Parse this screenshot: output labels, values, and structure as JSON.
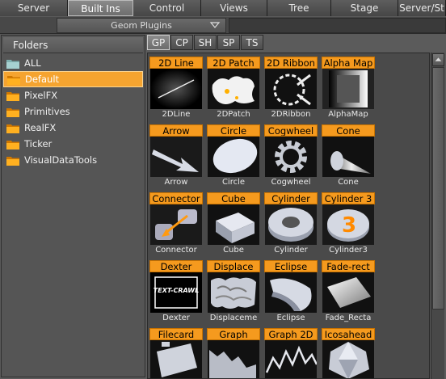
{
  "top_tabs": [
    "Server",
    "Built Ins",
    "Control",
    "Views",
    "Tree",
    "Stage",
    "Server/St"
  ],
  "active_top_tab": "Built Ins",
  "plugin_select": {
    "value": "Geom Plugins"
  },
  "folders_header": "Folders",
  "folders": [
    "ALL",
    "Default",
    "PixelFX",
    "Primitives",
    "RealFX",
    "Ticker",
    "VisualDataTools"
  ],
  "selected_folder": "Default",
  "sub_tabs": [
    "GP",
    "CP",
    "SH",
    "SP",
    "TS"
  ],
  "active_sub_tab": "GP",
  "items": [
    {
      "title": "2D Line",
      "caption": "2DLine",
      "icon": "line-icon"
    },
    {
      "title": "2D Patch",
      "caption": "2DPatch",
      "icon": "patch-icon"
    },
    {
      "title": "2D Ribbon",
      "caption": "2DRibbon",
      "icon": "ribbon-icon"
    },
    {
      "title": "Alpha Map",
      "caption": "AlphaMap",
      "icon": "alpha-map-icon"
    },
    {
      "title": "Arrow",
      "caption": "Arrow",
      "icon": "arrow-icon"
    },
    {
      "title": "Circle",
      "caption": "Circle",
      "icon": "circle-icon"
    },
    {
      "title": "Cogwheel",
      "caption": "Cogwheel",
      "icon": "cogwheel-icon"
    },
    {
      "title": "Cone",
      "caption": "Cone",
      "icon": "cone-icon"
    },
    {
      "title": "Connector",
      "caption": "Connector",
      "icon": "connector-icon"
    },
    {
      "title": "Cube",
      "caption": "Cube",
      "icon": "cube-icon"
    },
    {
      "title": "Cylinder",
      "caption": "Cylinder",
      "icon": "cylinder-icon"
    },
    {
      "title": "Cylinder 3",
      "caption": "Cylinder3",
      "icon": "cylinder3-icon"
    },
    {
      "title": "Dexter",
      "caption": "Dexter",
      "icon": "dexter-icon",
      "badge": "TEXT-CRAWL"
    },
    {
      "title": "Displace",
      "caption": "Displaceme",
      "icon": "displace-icon"
    },
    {
      "title": "Eclipse",
      "caption": "Eclipse",
      "icon": "eclipse-icon"
    },
    {
      "title": "Fade-rect",
      "caption": "Fade_Recta",
      "icon": "fade-rect-icon"
    },
    {
      "title": "Filecard",
      "caption": "",
      "icon": "filecard-icon"
    },
    {
      "title": "Graph",
      "caption": "",
      "icon": "graph-icon"
    },
    {
      "title": "Graph 2D",
      "caption": "",
      "icon": "graph2d-icon"
    },
    {
      "title": "Icosahead",
      "caption": "",
      "icon": "icosahead-icon"
    }
  ]
}
